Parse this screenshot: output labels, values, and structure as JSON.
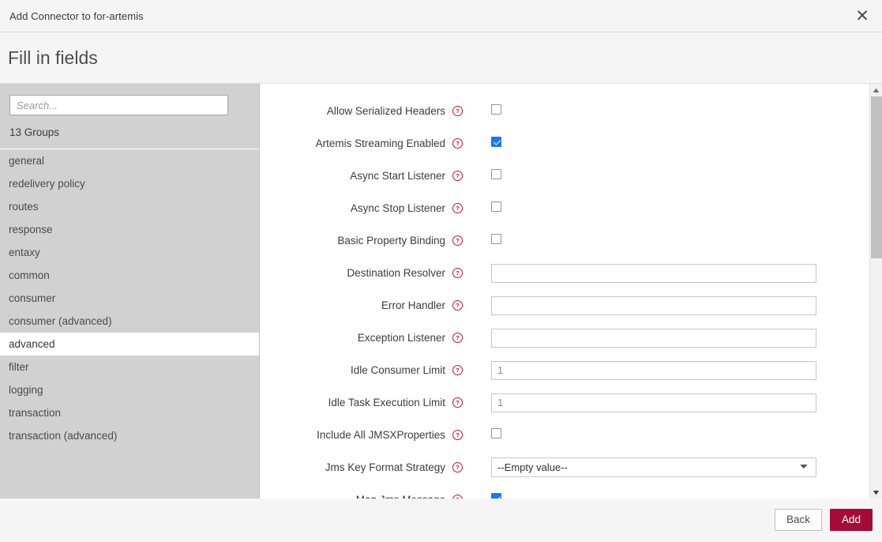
{
  "titlebar": {
    "title": "Add Connector to for-artemis",
    "close_label": "✕"
  },
  "wizard": {
    "heading": "Fill in fields"
  },
  "sidebar": {
    "search_placeholder": "Search...",
    "search_value": "",
    "groups_count_label": "13 Groups",
    "items": [
      {
        "label": "general",
        "selected": false
      },
      {
        "label": "redelivery policy",
        "selected": false
      },
      {
        "label": "routes",
        "selected": false
      },
      {
        "label": "response",
        "selected": false
      },
      {
        "label": "entaxy",
        "selected": false
      },
      {
        "label": "common",
        "selected": false
      },
      {
        "label": "consumer",
        "selected": false
      },
      {
        "label": "consumer (advanced)",
        "selected": false
      },
      {
        "label": "advanced",
        "selected": true
      },
      {
        "label": "filter",
        "selected": false
      },
      {
        "label": "logging",
        "selected": false
      },
      {
        "label": "transaction",
        "selected": false
      },
      {
        "label": "transaction (advanced)",
        "selected": false
      }
    ]
  },
  "form": {
    "help_icon_name": "help-circle-icon",
    "fields": [
      {
        "label": "Allow Serialized Headers",
        "type": "checkbox",
        "checked": false
      },
      {
        "label": "Artemis Streaming Enabled",
        "type": "checkbox",
        "checked": true
      },
      {
        "label": "Async Start Listener",
        "type": "checkbox",
        "checked": false
      },
      {
        "label": "Async Stop Listener",
        "type": "checkbox",
        "checked": false
      },
      {
        "label": "Basic Property Binding",
        "type": "checkbox",
        "checked": false
      },
      {
        "label": "Destination Resolver",
        "type": "text",
        "value": "",
        "placeholder": ""
      },
      {
        "label": "Error Handler",
        "type": "text",
        "value": "",
        "placeholder": ""
      },
      {
        "label": "Exception Listener",
        "type": "text",
        "value": "",
        "placeholder": ""
      },
      {
        "label": "Idle Consumer Limit",
        "type": "text",
        "value": "",
        "placeholder": "1"
      },
      {
        "label": "Idle Task Execution Limit",
        "type": "text",
        "value": "",
        "placeholder": "1"
      },
      {
        "label": "Include All JMSXProperties",
        "type": "checkbox",
        "checked": false
      },
      {
        "label": "Jms Key Format Strategy",
        "type": "select",
        "value": "--Empty value--",
        "options": [
          "--Empty value--"
        ]
      },
      {
        "label": "Map Jms Message",
        "type": "checkbox",
        "checked": true
      }
    ]
  },
  "scrollbar": {
    "up_arrow": "▲",
    "down_arrow": "▼"
  },
  "footer": {
    "back_label": "Back",
    "add_label": "Add"
  },
  "colors": {
    "accent": "#a30d35",
    "help_icon": "#c8102e",
    "checkbox_checked": "#1878ef",
    "sidebar_bg": "#d1d1d1",
    "chrome_bg": "#f5f5f5"
  }
}
